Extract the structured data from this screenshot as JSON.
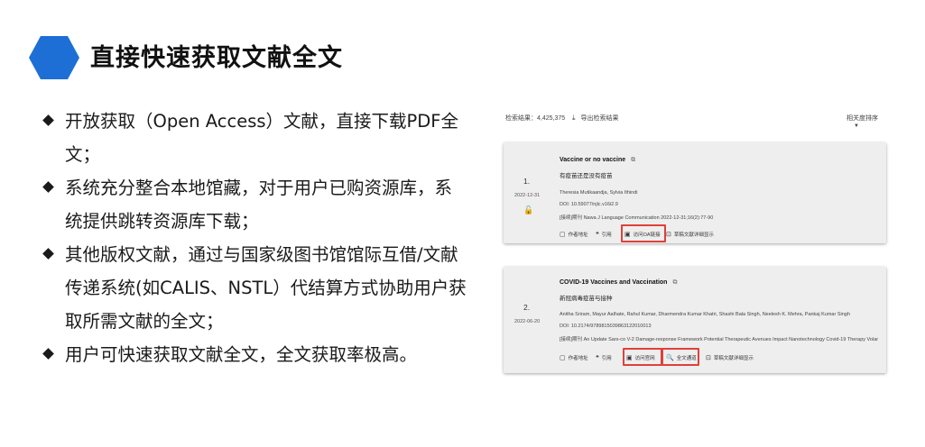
{
  "slide": {
    "title": "直接快速获取文献全文",
    "accent_color": "#1d6fd6",
    "bullets": [
      "开放获取（Open Access）文献，直接下载PDF全文；",
      "系统充分整合本地馆藏，对于用户已购资源库，系统提供跳转资源库下载；",
      "其他版权文献，通过与国家级图书馆馆际互借/文献传递系统(如CALIS、NSTL）代结算方式协助用户获取所需文献的全文；",
      "用户可快速获取文献全文，全文获取率极高。"
    ]
  },
  "results": {
    "count_label": "检索结果：4,425,375",
    "export_label": "导出检索结果",
    "sort_label": "相关度排序",
    "highlight_color": "#e0403a",
    "items": [
      {
        "index": "1.",
        "date": "2022-12-31",
        "title": "Vaccine or no vaccine",
        "subtitle": "有疫苗还是没有疫苗",
        "authors": "Theresia Mutikaandja, Sylvia Ithindi",
        "doi": "DOI: 10.59077/njlc.v16i2.9",
        "source": "[接续]期刊  Nawa J Language Communication 2022-12-31;16(2):77-90",
        "actions": [
          "作者地址",
          "引用",
          "访问OA链接",
          "草稿文献详细显示"
        ]
      },
      {
        "index": "2.",
        "date": "2022-06-20",
        "title": "COVID-19 Vaccines and Vaccination",
        "subtitle": "新冠病毒疫苗与接种",
        "authors": "Anitha Sriram, Mayur Aalhate, Rahul Kumar, Dharmendra Kumar Khatri, Shashi Bala Singh, Neelesh K. Mehra, Pankaj Kumar Singh",
        "doi": "DOI: 10.2174/9789815039863122010013",
        "source": "[接续]期刊  An Update Sars-co V-2 Damage-response Framework Potential Therapeutic Avenues Impact Nanotechnology Covid-19 Therapy Volar",
        "actions": [
          "作者地址",
          "引用",
          "访问官网",
          "全文通道",
          "草稿文献详细显示"
        ]
      }
    ]
  }
}
